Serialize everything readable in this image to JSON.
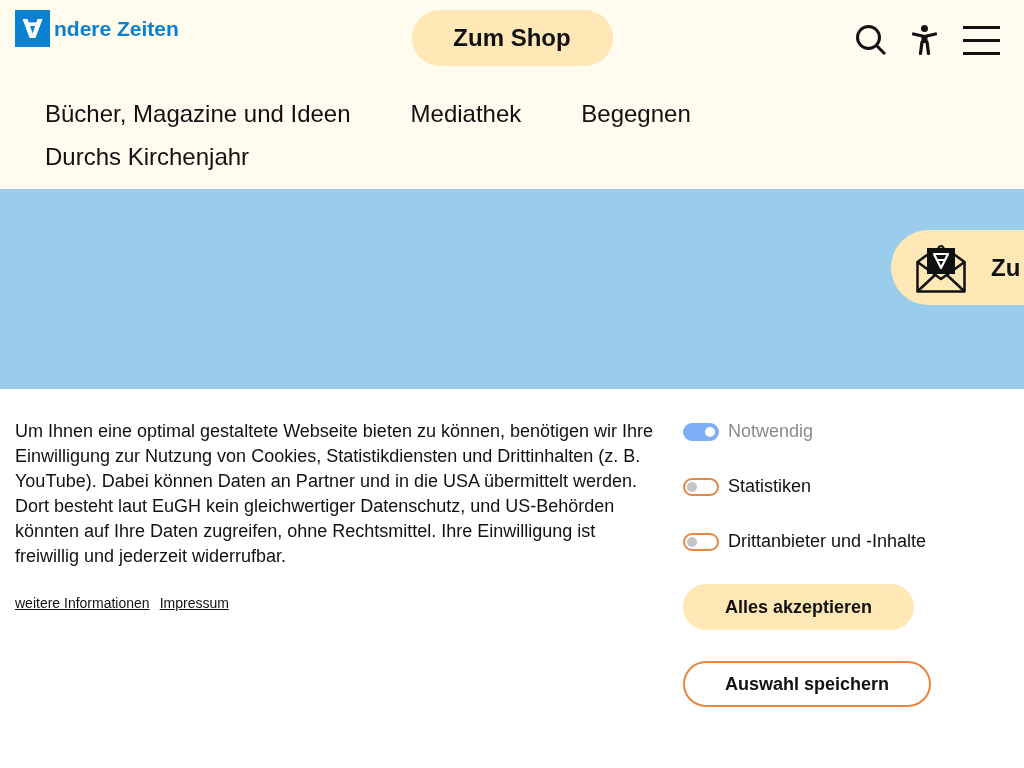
{
  "header": {
    "logo": {
      "mark": "∀",
      "text": "ndere Zeiten"
    },
    "shop_button": "Zum Shop"
  },
  "nav": [
    {
      "label": "Bücher, Magazine und Ideen"
    },
    {
      "label": "Mediathek"
    },
    {
      "label": "Begegnen"
    },
    {
      "label": "Durchs Kirchenjahr"
    }
  ],
  "banner": {
    "newsletter_button": "Zu"
  },
  "cookie_consent": {
    "text": "Um Ihnen eine optimal gestaltete Webseite bieten zu können, benötigen wir Ihre Einwilligung zur Nutzung von Cookies, Statistikdiensten und Drittinhalten (z. B. YouTube). Dabei können Daten an Partner und in die USA übermittelt werden. Dort besteht laut EuGH kein gleichwertiger Datenschutz, und US-Behörden könnten auf Ihre Daten zugreifen, ohne Rechtsmittel. Ihre Einwilligung ist freiwillig und jederzeit widerrufbar.",
    "links": [
      "weitere Informationen",
      "Impressum"
    ],
    "options": [
      {
        "label": "Notwendig",
        "on": true,
        "disabled": true
      },
      {
        "label": "Statistiken",
        "on": false,
        "disabled": false
      },
      {
        "label": "Drittanbieter und -Inhalte",
        "on": false,
        "disabled": false
      }
    ],
    "buttons": [
      {
        "label": "Alles akzeptieren",
        "kind": "filled"
      },
      {
        "label": "Auswahl speichern",
        "kind": "outline"
      }
    ]
  }
}
